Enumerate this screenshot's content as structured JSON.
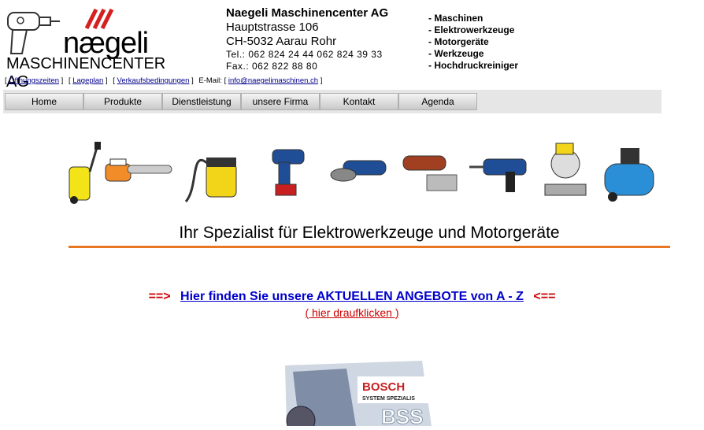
{
  "logo": {
    "brand": "nægeli",
    "subtitle": "MASCHINENCENTER AG"
  },
  "company": {
    "name": "Naegeli Maschinencenter AG",
    "street": "Hauptstrasse 106",
    "city": "CH-5032 Aarau Rohr",
    "tel": "Tel.:  062 824 24 44   062 824 39 33",
    "fax": "Fax.: 062 822 88 80"
  },
  "categories": [
    "- Maschinen",
    "- Elektrowerkzeuge",
    "- Motorgeräte",
    "- Werkzeuge",
    "- Hochdruckreiniger"
  ],
  "links": {
    "opening_hours": "Öffnungszeiten",
    "map": "Lageplan",
    "terms": "Verkaufsbedingungen",
    "email_label": "E-Mail:",
    "email": "info@naegelimaschinen.ch"
  },
  "nav": [
    "Home",
    "Produkte",
    "Dienstleistung",
    "unsere Firma",
    "Kontakt",
    "Agenda"
  ],
  "tools": [
    "pressure-washer",
    "chainsaw",
    "vacuum-cleaner",
    "cordless-drill",
    "angle-grinder",
    "multitool",
    "rotary-hammer",
    "miter-saw",
    "compressor"
  ],
  "headline": "Ihr Spezialist für Elektrowerkzeuge und Motorgeräte",
  "offer": {
    "arrow_left": "==>",
    "link": "Hier finden Sie unsere AKTUELLEN ANGEBOTE von A - Z",
    "arrow_right": "<==",
    "click": "( hier draufklicken )"
  },
  "bosch": {
    "brand": "BOSCH",
    "tagline": "SYSTEM SPEZIALIS",
    "badge": "BSS"
  },
  "colors": {
    "accent_orange": "#e87722",
    "link_blue": "#0000cc",
    "arrow_red": "#cc0000",
    "logo_red": "#d42020"
  }
}
